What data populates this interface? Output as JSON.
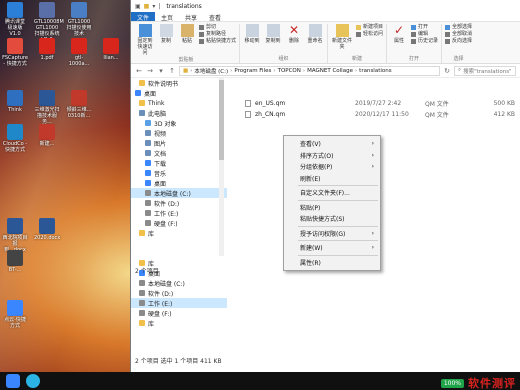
{
  "desktop": {
    "icons": [
      {
        "label": "腾讯课堂\n极速版V1.0",
        "color": "#2b7fd6"
      },
      {
        "label": "GTL10008M GTL1000扫描仪系统V1.0",
        "color": "#5a6fa8"
      },
      {
        "label": "GTL1000扫描仪使用技术",
        "color": "#4a7fc6"
      },
      {
        "label": "FSCapture - 快捷方式",
        "color": "#e34b3c"
      },
      {
        "label": "1.pdf",
        "color": "#d9261c"
      },
      {
        "label": "gtl-1000a...",
        "color": "#d9261c"
      },
      {
        "label": "Ilian...",
        "color": "#d9261c"
      },
      {
        "label": "Think",
        "color": "#2f6fbf"
      },
      {
        "label": "CloudCo - 快捷方式",
        "color": "#1e88c8"
      },
      {
        "label": "三维激光扫描技术服务...",
        "color": "#2b5797"
      },
      {
        "label": "倾斜三维... 0310新...",
        "color": "#c0392b"
      },
      {
        "label": "新建...",
        "color": "#c0392b"
      },
      {
        "label": "西北院项目报到...docx",
        "color": "#2b5797"
      },
      {
        "label": "2020.docx",
        "color": "#2b5797"
      },
      {
        "label": "BT-...",
        "color": "#444"
      },
      {
        "label": "点云-快捷方式",
        "color": "#3a86ff"
      }
    ]
  },
  "window": {
    "title": "translations",
    "tabs": [
      "文件",
      "主页",
      "共享",
      "查看"
    ],
    "ribbon": {
      "clipboard": {
        "name": "剪贴板",
        "pin": "固定到快速访问",
        "copy": "复制",
        "paste": "粘贴",
        "cut": "剪切",
        "copy_path": "复制路径",
        "paste_shortcut": "粘贴快捷方式"
      },
      "organize": {
        "name": "组织",
        "move": "移动到",
        "copy_to": "复制到",
        "delete": "删除",
        "rename": "重命名"
      },
      "new": {
        "name": "新建",
        "folder": "新建文件夹",
        "item": "新建项目",
        "easy": "轻松访问"
      },
      "open": {
        "name": "打开",
        "props": "属性",
        "open": "打开",
        "edit": "编辑",
        "history": "历史记录"
      },
      "select": {
        "name": "选择",
        "all": "全部选择",
        "none": "全部取消",
        "invert": "反向选择"
      }
    },
    "path": [
      "本地磁盘 (C:)",
      "Program Files",
      "TOPCON",
      "MAGNET Collage",
      "translations"
    ],
    "search_placeholder": "搜索\"translations\"",
    "sidebar": [
      {
        "label": "软件说明书",
        "color": "#f0c04a",
        "indent": 8
      },
      {
        "label": "桌面",
        "color": "#3a86ff",
        "indent": 4
      },
      {
        "label": "Think",
        "color": "#f0c04a",
        "indent": 8
      },
      {
        "label": "此电脑",
        "color": "#6b8fb8",
        "indent": 8
      },
      {
        "label": "3D 对象",
        "color": "#5aa0e6",
        "indent": 14
      },
      {
        "label": "视频",
        "color": "#6b8fb8",
        "indent": 14
      },
      {
        "label": "图片",
        "color": "#6b8fb8",
        "indent": 14
      },
      {
        "label": "文档",
        "color": "#6b8fb8",
        "indent": 14
      },
      {
        "label": "下载",
        "color": "#3a86ff",
        "indent": 14
      },
      {
        "label": "音乐",
        "color": "#3a86ff",
        "indent": 14
      },
      {
        "label": "桌面",
        "color": "#3a86ff",
        "indent": 14
      },
      {
        "label": "本地磁盘 (C:)",
        "color": "#8a8a8a",
        "indent": 14,
        "selected": true
      },
      {
        "label": "软件 (D:)",
        "color": "#8a8a8a",
        "indent": 14
      },
      {
        "label": "工作 (E:)",
        "color": "#8a8a8a",
        "indent": 14
      },
      {
        "label": "硬盘 (F:)",
        "color": "#8a8a8a",
        "indent": 14
      },
      {
        "label": "库",
        "color": "#f0c04a",
        "indent": 8
      }
    ],
    "status1": "2 个项目",
    "sidebar2": [
      {
        "label": "库",
        "color": "#f0c04a",
        "indent": 8
      },
      {
        "label": "桌面",
        "color": "#3a86ff",
        "indent": 8
      },
      {
        "label": "本地磁盘 (C:)",
        "color": "#8a8a8a",
        "indent": 8
      },
      {
        "label": "软件 (D:)",
        "color": "#8a8a8a",
        "indent": 8
      },
      {
        "label": "工作 (E:)",
        "color": "#8a8a8a",
        "indent": 8,
        "selected": true
      },
      {
        "label": "硬盘 (F:)",
        "color": "#8a8a8a",
        "indent": 8
      },
      {
        "label": "库",
        "color": "#f0c04a",
        "indent": 8
      }
    ],
    "status2": "2 个项目   选中 1 个项目  411 KB",
    "files": [
      {
        "name": "en_US.qm",
        "date": "2019/7/27 2:42",
        "type": "QM 文件",
        "size": "500 KB"
      },
      {
        "name": "zh_CN.qm",
        "date": "2020/12/17 11:50",
        "type": "QM 文件",
        "size": "412 KB"
      }
    ]
  },
  "context_menu": {
    "groups": [
      [
        {
          "label": "查看(V)",
          "arrow": "›"
        },
        {
          "label": "排序方式(O)",
          "arrow": "›"
        },
        {
          "label": "分组依据(P)",
          "arrow": "›"
        },
        {
          "label": "刷新(E)",
          "arrow": ""
        }
      ],
      [
        {
          "label": "自定义文件夹(F)...",
          "arrow": ""
        }
      ],
      [
        {
          "label": "粘贴(P)",
          "arrow": ""
        },
        {
          "label": "粘贴快捷方式(S)",
          "arrow": ""
        }
      ],
      [
        {
          "label": "授予访问权限(G)",
          "arrow": "›"
        }
      ],
      [
        {
          "label": "新建(W)",
          "arrow": "›"
        }
      ],
      [
        {
          "label": "属性(R)",
          "arrow": ""
        }
      ]
    ]
  },
  "taskbar": {
    "battery": "100%",
    "watermark": "软件测评"
  }
}
